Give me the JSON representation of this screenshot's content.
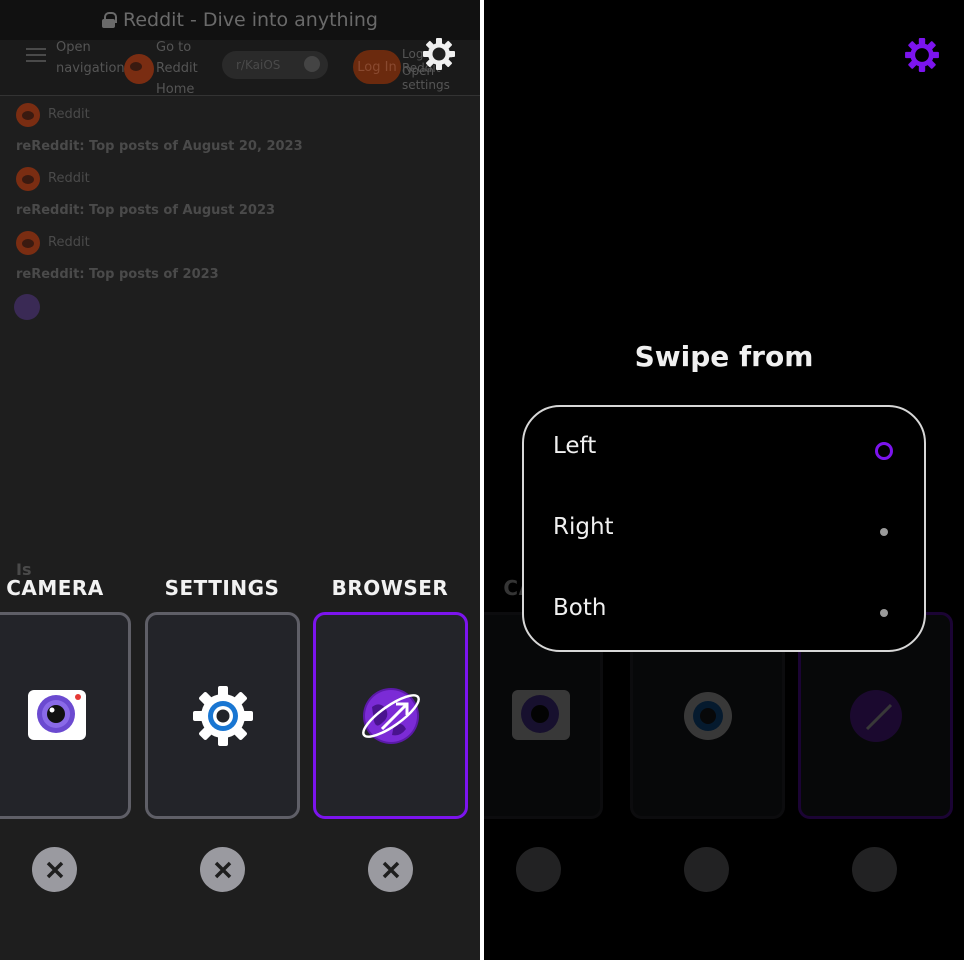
{
  "left_screen": {
    "page_title": "Reddit - Dive into anything",
    "nav": {
      "open_navigation": "Open navigation",
      "go_home": "Go to Reddit Home",
      "subreddit_chip": "r/KaiOS",
      "login": "Log In",
      "login_note": "Log in to Reddit",
      "open_settings": "Open settings"
    },
    "feed": [
      {
        "source": "Reddit",
        "title": "reReddit: Top posts of August 20, 2023"
      },
      {
        "source": "Reddit",
        "title": "reReddit: Top posts of August 2023"
      },
      {
        "source": "Reddit",
        "title": "reReddit: Top posts of 2023"
      }
    ],
    "stray_text": "Is",
    "recent_apps": [
      {
        "label": "CAMERA",
        "icon": "camera-icon"
      },
      {
        "label": "SETTINGS",
        "icon": "settings-app-icon"
      },
      {
        "label": "BROWSER",
        "icon": "browser-icon",
        "selected": true
      }
    ]
  },
  "right_screen": {
    "dialog_title": "Swipe from",
    "options": [
      {
        "label": "Left",
        "selected": true
      },
      {
        "label": "Right",
        "selected": false
      },
      {
        "label": "Both",
        "selected": false
      }
    ],
    "background_label": "CA"
  },
  "colors": {
    "accent": "#7c14ee",
    "card_border": "#5f5f67",
    "close_button": "#9a9aa0"
  }
}
